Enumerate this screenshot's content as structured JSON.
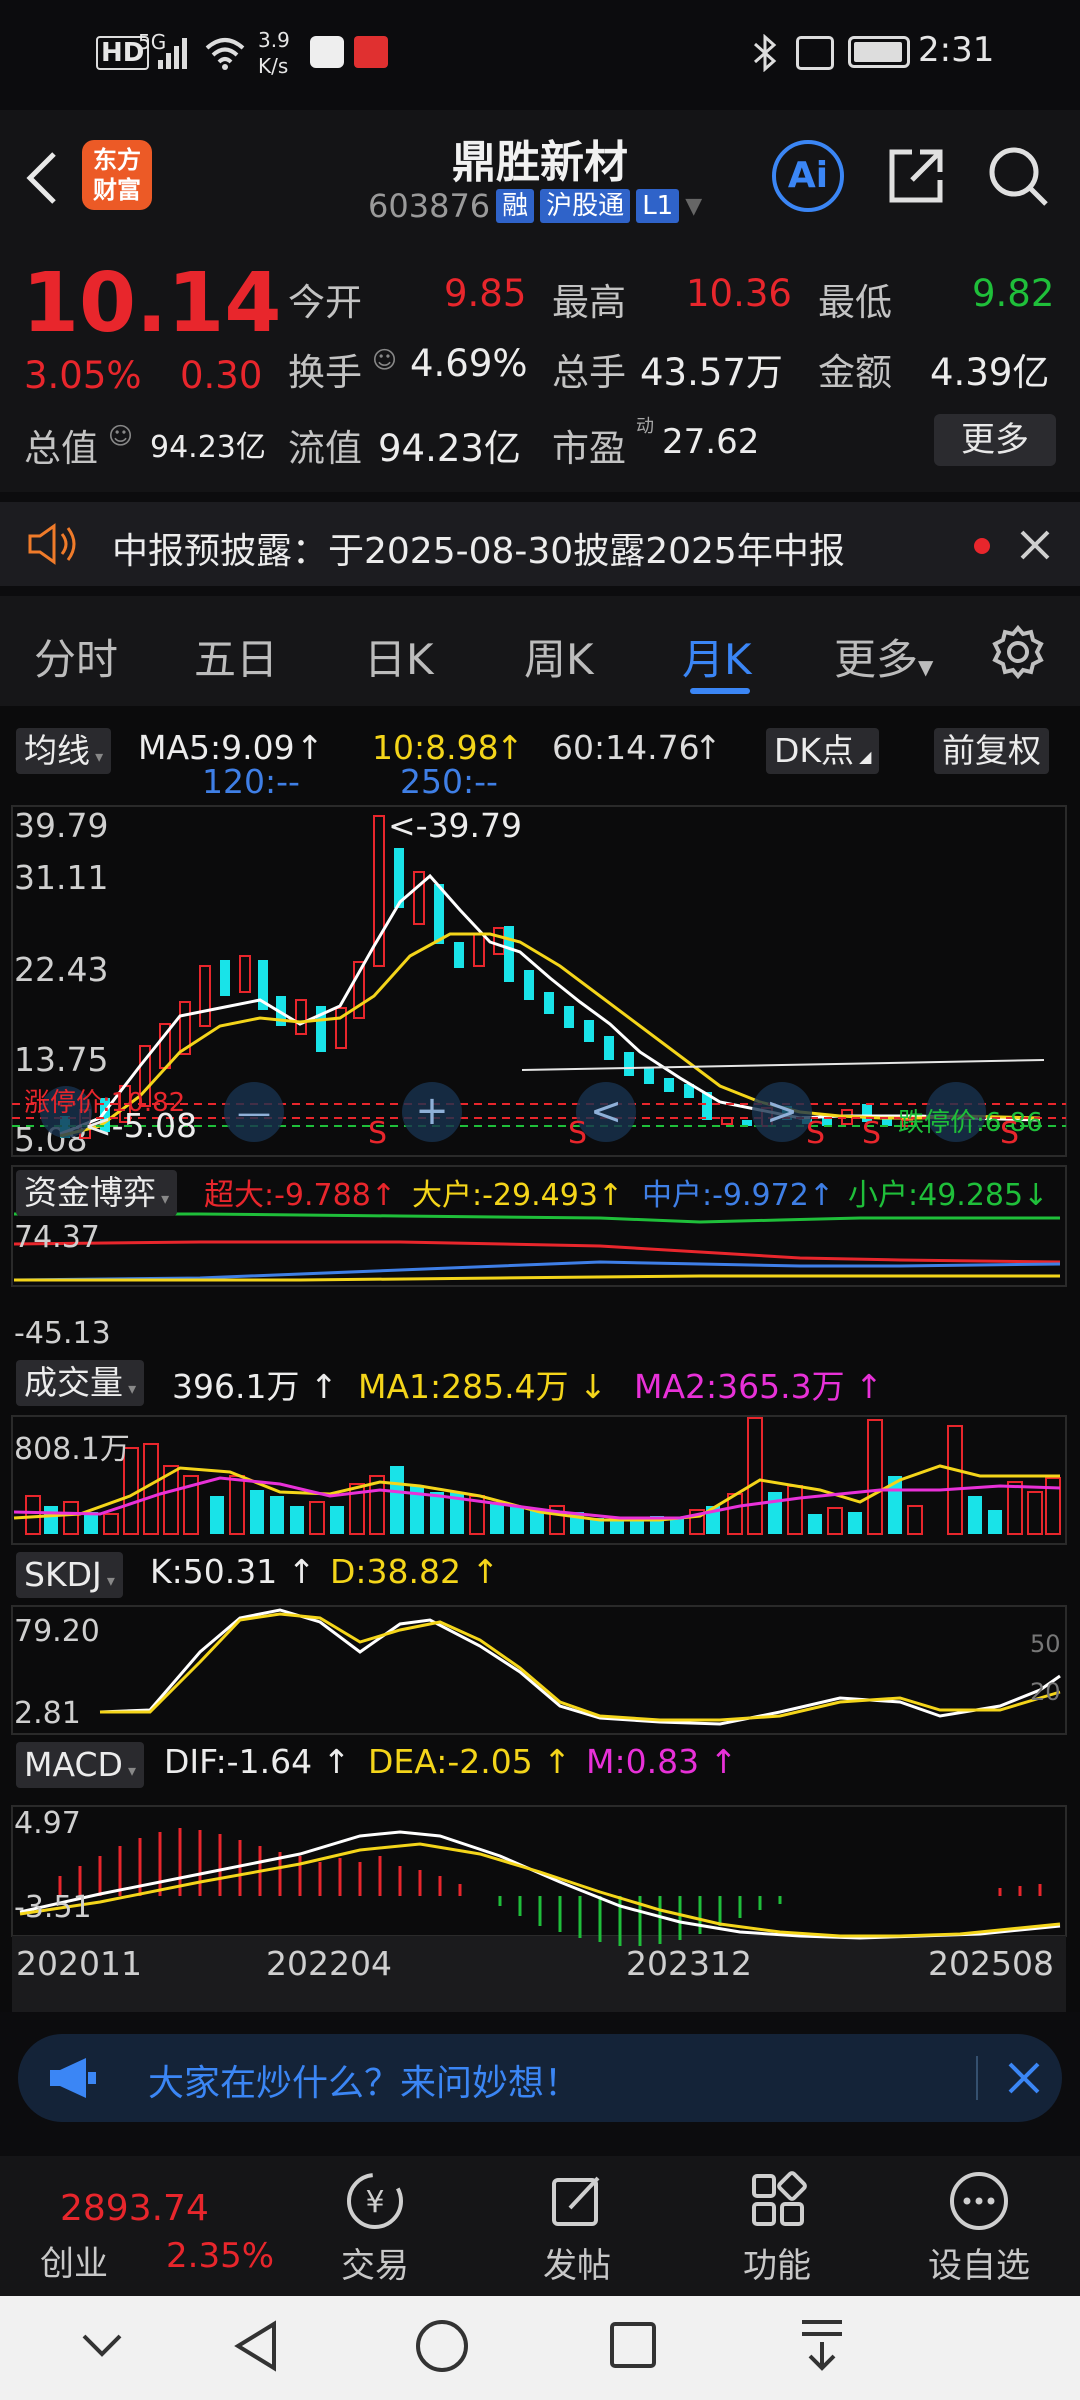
{
  "status": {
    "network": "HD",
    "signal": "5G",
    "speed_top": "3.9",
    "speed_bottom": "K/s",
    "time": "2:31"
  },
  "header": {
    "logo_line1": "东方",
    "logo_line2": "财富",
    "title": "鼎胜新材",
    "code": "603876",
    "tag_rong": "融",
    "tag_hgt": "沪股通",
    "tag_level": "L1",
    "ai_label": "Ai"
  },
  "quote": {
    "price": "10.14",
    "change_pct": "3.05%",
    "change": "0.30",
    "open_label": "今开",
    "open": "9.85",
    "high_label": "最高",
    "high": "10.36",
    "low_label": "最低",
    "low": "9.82",
    "turnover_label": "换手",
    "turnover": "4.69%",
    "volume_label": "总手",
    "volume": "43.57万",
    "amount_label": "金额",
    "amount": "4.39亿",
    "mktcap_label": "总值",
    "mktcap": "94.23亿",
    "float_label": "流值",
    "float": "94.23亿",
    "pe_label": "市盈",
    "pe_sup": "动",
    "pe": "27.62",
    "more_button": "更多"
  },
  "notice": {
    "text": "中报预披露：于2025-08-30披露2025年中报"
  },
  "tabs": [
    "分时",
    "五日",
    "日K",
    "周K",
    "月K",
    "更多"
  ],
  "active_tab": "月K",
  "ma_bar": {
    "selector": "均线",
    "ma5": "MA5:9.09",
    "ma10": "10:8.98",
    "ma60": "60:14.76",
    "ma120": "120:--",
    "ma250": "250:--",
    "dk_button": "DK点",
    "adjust_button": "前复权"
  },
  "kline": {
    "y_labels": [
      "39.79",
      "31.11",
      "22.43",
      "13.75",
      "5.08"
    ],
    "high_label": "39.79",
    "low_label": "5.08",
    "limit_up_label": "涨停价:10.82",
    "limit_down_label": "跌停价:6.86",
    "s_marks": [
      "S",
      "S",
      "S",
      "S",
      "S"
    ]
  },
  "fund": {
    "selector": "资金博弈",
    "super": "超大:-9.788",
    "big": "大户:-29.493",
    "mid": "中户:-9.972",
    "small": "小户:49.285",
    "y_top": "74.37",
    "y_bottom": "-45.13"
  },
  "volume": {
    "selector": "成交量",
    "value": "396.1万",
    "ma1": "MA1:285.4万",
    "ma2": "MA2:365.3万",
    "y_top": "808.1万"
  },
  "skdj": {
    "selector": "SKDJ",
    "k": "K:50.31",
    "d": "D:38.82",
    "y_top": "79.20",
    "y_bottom": "2.81",
    "ref_high": "50",
    "ref_low": "20"
  },
  "macd": {
    "selector": "MACD",
    "dif": "DIF:-1.64",
    "dea": "DEA:-2.05",
    "m": "M:0.83",
    "y_top": "4.97",
    "y_bottom": "-3.51"
  },
  "x_axis": [
    "202011",
    "202204",
    "202312",
    "202508"
  ],
  "banner": {
    "text": "大家在炒什么？来问妙想！"
  },
  "bottom_nav": {
    "index_value": "2893.74",
    "index_name": "创业",
    "index_pct": "2.35%",
    "items": [
      "交易",
      "发帖",
      "功能",
      "设自选"
    ]
  },
  "colors": {
    "up": "#e8262c",
    "down": "#19e3e8",
    "ma5": "#ffffff",
    "ma10": "#f4d51a",
    "accent": "#3b86f5"
  }
}
